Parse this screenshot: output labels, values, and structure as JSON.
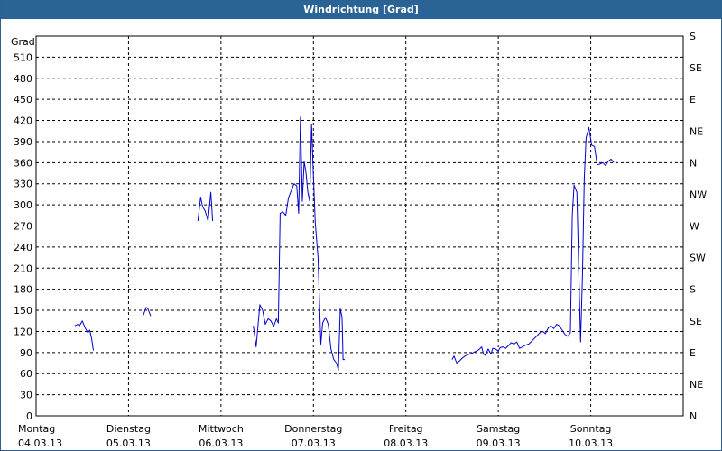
{
  "window": {
    "title": "Windrichtung [Grad]"
  },
  "chart_data": {
    "type": "line",
    "title": "Windrichtung [Grad]",
    "ylabel": "Grad",
    "ylim": [
      0,
      540
    ],
    "yticks": [
      0,
      30,
      60,
      90,
      120,
      150,
      180,
      210,
      240,
      270,
      300,
      330,
      360,
      390,
      420,
      450,
      480,
      510
    ],
    "right_axis_labels": [
      "N",
      "NE",
      "E",
      "SE",
      "S",
      "SW",
      "W",
      "NW",
      "N",
      "NE",
      "E",
      "SE",
      "S"
    ],
    "right_axis_values": [
      0,
      45,
      90,
      135,
      180,
      225,
      270,
      315,
      360,
      405,
      450,
      495,
      540
    ],
    "xlim": [
      0,
      7
    ],
    "x_unit": "days from Montag 04.03.13 00:00",
    "xticks": [
      {
        "x": 0,
        "day": "Montag",
        "date": "04.03.13"
      },
      {
        "x": 1,
        "day": "Dienstag",
        "date": "05.03.13"
      },
      {
        "x": 2,
        "day": "Mittwoch",
        "date": "06.03.13"
      },
      {
        "x": 3,
        "day": "Donnerstag",
        "date": "07.03.13"
      },
      {
        "x": 4,
        "day": "Freitag",
        "date": "08.03.13"
      },
      {
        "x": 5,
        "day": "Samstag",
        "date": "09.03.13"
      },
      {
        "x": 6,
        "day": "Sonntag",
        "date": "10.03.13"
      }
    ],
    "grid": true,
    "line_color": "#0000cc",
    "series": [
      {
        "name": "",
        "segments": [
          [
            [
              0.42,
              128
            ],
            [
              0.45,
              130
            ],
            [
              0.47,
              128
            ],
            [
              0.5,
              135
            ],
            [
              0.53,
              125
            ],
            [
              0.56,
              118
            ],
            [
              0.58,
              122
            ],
            [
              0.6,
              110
            ],
            [
              0.62,
              93
            ]
          ],
          [
            [
              1.16,
              143
            ],
            [
              1.19,
              154
            ],
            [
              1.21,
              152
            ],
            [
              1.24,
              142
            ]
          ],
          [
            [
              1.75,
              277
            ],
            [
              1.78,
              311
            ],
            [
              1.8,
              298
            ],
            [
              1.83,
              291
            ],
            [
              1.86,
              277
            ],
            [
              1.89,
              318
            ],
            [
              1.91,
              277
            ]
          ],
          [
            [
              2.35,
              128
            ],
            [
              2.38,
              98
            ],
            [
              2.42,
              158
            ],
            [
              2.45,
              150
            ],
            [
              2.48,
              130
            ],
            [
              2.51,
              138
            ],
            [
              2.54,
              135
            ],
            [
              2.57,
              127
            ],
            [
              2.6,
              138
            ],
            [
              2.62,
              132
            ],
            [
              2.64,
              288
            ],
            [
              2.67,
              290
            ],
            [
              2.7,
              285
            ],
            [
              2.73,
              310
            ],
            [
              2.76,
              320
            ],
            [
              2.79,
              330
            ],
            [
              2.82,
              327
            ],
            [
              2.84,
              288
            ],
            [
              2.86,
              425
            ],
            [
              2.88,
              305
            ],
            [
              2.9,
              362
            ],
            [
              2.92,
              345
            ],
            [
              2.94,
              318
            ],
            [
              2.96,
              305
            ],
            [
              2.98,
              415
            ],
            [
              3.0,
              340
            ],
            [
              3.02,
              275
            ],
            [
              3.05,
              225
            ],
            [
              3.08,
              102
            ],
            [
              3.1,
              132
            ],
            [
              3.13,
              140
            ],
            [
              3.16,
              130
            ],
            [
              3.19,
              95
            ],
            [
              3.22,
              80
            ],
            [
              3.25,
              75
            ],
            [
              3.27,
              65
            ],
            [
              3.29,
              152
            ],
            [
              3.31,
              140
            ],
            [
              3.32,
              80
            ],
            [
              3.34,
              80
            ]
          ],
          [
            [
              4.5,
              80
            ],
            [
              4.52,
              85
            ],
            [
              4.55,
              75
            ],
            [
              4.58,
              78
            ],
            [
              4.61,
              82
            ],
            [
              4.64,
              85
            ],
            [
              4.67,
              87
            ],
            [
              4.7,
              88
            ],
            [
              4.73,
              90
            ],
            [
              4.76,
              92
            ],
            [
              4.79,
              94
            ],
            [
              4.82,
              98
            ],
            [
              4.84,
              88
            ],
            [
              4.86,
              86
            ],
            [
              4.89,
              95
            ],
            [
              4.92,
              88
            ],
            [
              4.94,
              96
            ],
            [
              4.97,
              95
            ],
            [
              5.0,
              92
            ],
            [
              5.02,
              97
            ],
            [
              5.05,
              98
            ],
            [
              5.08,
              96
            ],
            [
              5.11,
              100
            ],
            [
              5.14,
              104
            ],
            [
              5.17,
              102
            ],
            [
              5.2,
              105
            ],
            [
              5.23,
              96
            ],
            [
              5.26,
              98
            ],
            [
              5.3,
              101
            ],
            [
              5.33,
              102
            ],
            [
              5.36,
              106
            ],
            [
              5.39,
              110
            ],
            [
              5.42,
              114
            ],
            [
              5.45,
              118
            ],
            [
              5.48,
              120
            ],
            [
              5.51,
              117
            ],
            [
              5.54,
              125
            ],
            [
              5.57,
              128
            ],
            [
              5.6,
              124
            ],
            [
              5.63,
              130
            ],
            [
              5.66,
              128
            ],
            [
              5.69,
              122
            ],
            [
              5.72,
              116
            ],
            [
              5.75,
              113
            ],
            [
              5.78,
              118
            ],
            [
              5.8,
              285
            ],
            [
              5.82,
              328
            ],
            [
              5.85,
              318
            ],
            [
              5.87,
              205
            ],
            [
              5.89,
              105
            ],
            [
              5.91,
              200
            ],
            [
              5.93,
              338
            ],
            [
              5.95,
              395
            ],
            [
              5.98,
              410
            ],
            [
              6.01,
              385
            ],
            [
              6.04,
              383
            ],
            [
              6.07,
              357
            ],
            [
              6.1,
              358
            ],
            [
              6.13,
              360
            ],
            [
              6.16,
              356
            ],
            [
              6.19,
              362
            ],
            [
              6.22,
              365
            ],
            [
              6.25,
              360
            ]
          ]
        ]
      }
    ]
  }
}
